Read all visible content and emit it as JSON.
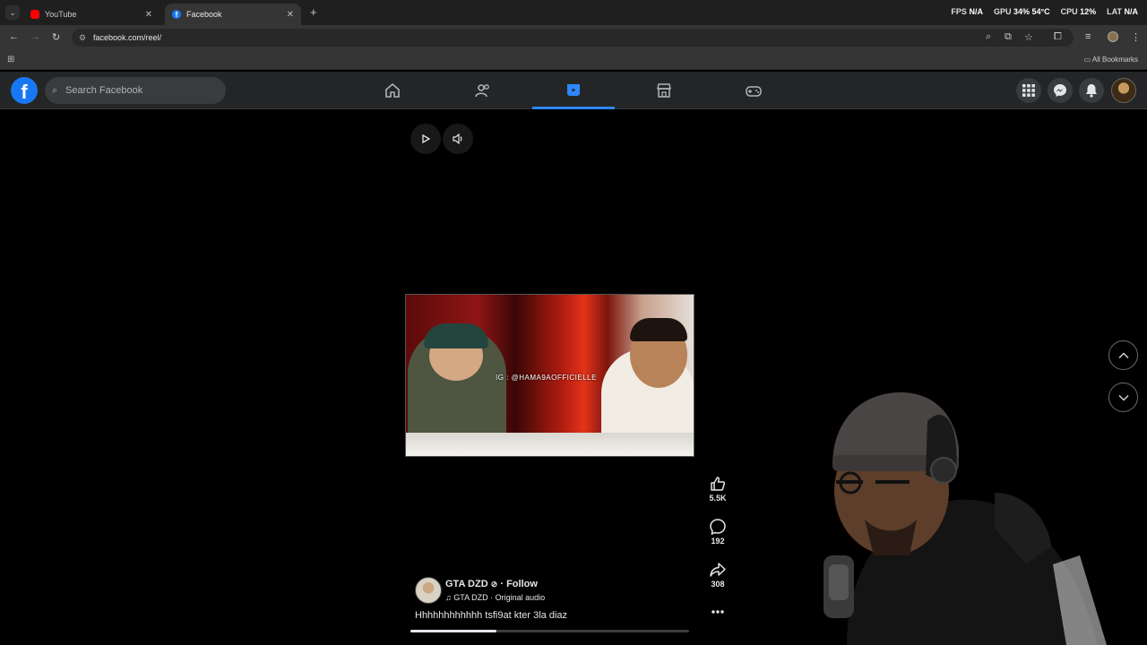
{
  "browser": {
    "tabs": [
      {
        "label": "YouTube",
        "active": false
      },
      {
        "label": "Facebook",
        "active": true
      }
    ],
    "url": "facebook.com/reel/",
    "bookmarks_label": "All Bookmarks",
    "stats": {
      "fps_label": "FPS",
      "fps_value": "N/A",
      "gpu_label": "GPU",
      "gpu_value": "34% 54°C",
      "cpu_label": "CPU",
      "cpu_value": "12%",
      "lat_label": "LAT",
      "lat_value": "N/A"
    }
  },
  "facebook": {
    "search_placeholder": "Search Facebook",
    "active_nav": "reels"
  },
  "reel": {
    "video_caption": "IG : @HAMA9AOFFICIELLE",
    "likes": "5.5K",
    "comments": "192",
    "shares": "308",
    "author": "GTA DZD",
    "follow_label": "· Follow",
    "audio": "GTA DZD · Original audio",
    "description": "Hhhhhhhhhhhh tsfi9at kter 3la diaz",
    "progress": 0.31
  },
  "colors": {
    "fb_blue": "#1877f2",
    "active_tab_indicator": "#2d88ff",
    "header_bg": "#242526"
  }
}
